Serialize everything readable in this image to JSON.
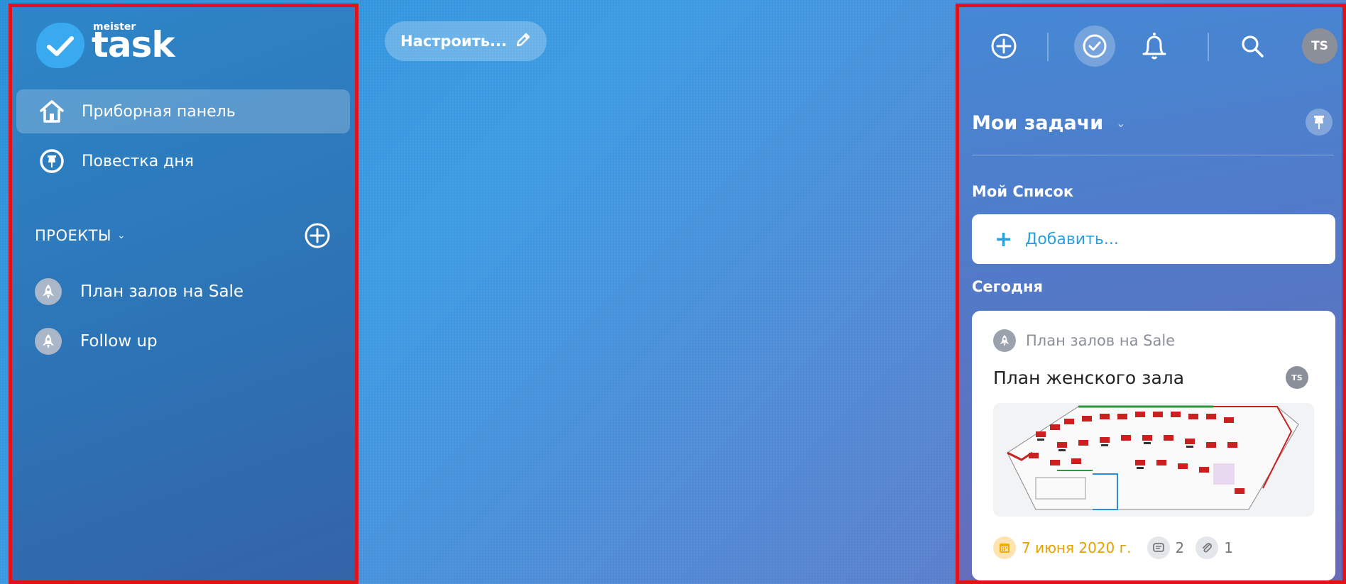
{
  "sidebar": {
    "logo": {
      "small": "meister",
      "large": "task"
    },
    "nav": [
      {
        "label": "Приборная панель",
        "icon": "home-icon",
        "active": true
      },
      {
        "label": "Повестка дня",
        "icon": "pin-circle-icon",
        "active": false
      }
    ],
    "projects_header": "ПРОЕКТЫ",
    "projects": [
      {
        "label": "План залов на Sale",
        "icon": "rocket-icon"
      },
      {
        "label": "Follow up",
        "icon": "rocket-icon"
      }
    ]
  },
  "main": {
    "customize_label": "Настроить..."
  },
  "right_panel": {
    "user_initials": "TS",
    "title": "Мои задачи",
    "my_list_label": "Мой Список",
    "add_placeholder": "Добавить...",
    "today_label": "Сегодня",
    "task": {
      "project": "План залов на Sale",
      "title": "План женского зала",
      "assignee": "TS",
      "due": "7 июня 2020 г.",
      "comments": "2",
      "attachments": "1"
    }
  },
  "colors": {
    "accent": "#2a9fe0",
    "due": "#e6a100",
    "highlight_border": "#e0131a"
  }
}
